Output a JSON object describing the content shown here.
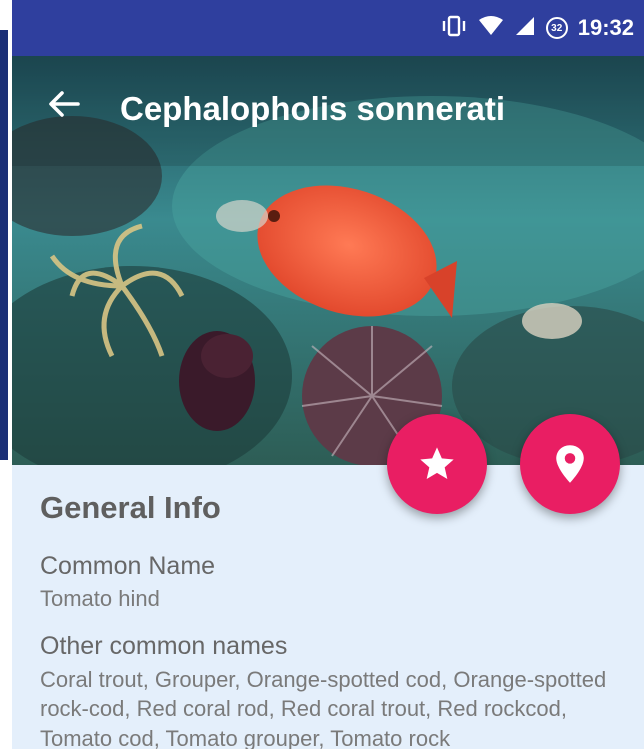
{
  "status_bar": {
    "time": "19:32",
    "battery_level": "32"
  },
  "header": {
    "title": "Cephalopholis sonnerati"
  },
  "actions": {
    "favorite_icon": "star-icon",
    "location_icon": "location-pin-icon"
  },
  "general_info": {
    "heading": "General Info",
    "common_name_label": "Common Name",
    "common_name_value": "Tomato hind",
    "other_names_label": "Other common names",
    "other_names_value": "Coral trout, Grouper, Orange-spotted cod, Orange-spotted rock-cod, Red coral rod, Red coral trout, Red rockcod, Tomato cod, Tomato grouper, Tomato rock"
  },
  "colors": {
    "status_bar": "#2f3f9e",
    "fab": "#e91e63",
    "content_bg": "#e4effb"
  }
}
